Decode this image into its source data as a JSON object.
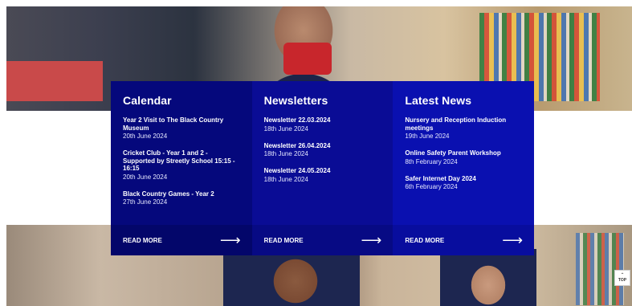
{
  "calendar": {
    "title": "Calendar",
    "items": [
      {
        "title": "Year 2 Visit to The Black Country Museum",
        "date": "20th June 2024"
      },
      {
        "title": "Cricket Club - Year 1 and 2 - Supported by Streetly School 15:15 - 16:15",
        "date": "20th June 2024"
      },
      {
        "title": "Black Country Games - Year 2",
        "date": "27th June 2024"
      }
    ],
    "read_more": "READ MORE"
  },
  "newsletters": {
    "title": "Newsletters",
    "items": [
      {
        "title": "Newsletter 22.03.2024",
        "date": "18th June 2024"
      },
      {
        "title": "Newsletter 26.04.2024",
        "date": "18th June 2024"
      },
      {
        "title": "Newsletter 24.05.2024",
        "date": "18th June 2024"
      }
    ],
    "read_more": "READ MORE"
  },
  "news": {
    "title": "Latest News",
    "items": [
      {
        "title": "Nursery and Reception Induction meetings",
        "date": "19th June 2024"
      },
      {
        "title": "Online Safety Parent Workshop",
        "date": "8th February 2024"
      },
      {
        "title": "Safer Internet Day 2024",
        "date": "6th February 2024"
      }
    ],
    "read_more": "READ MORE"
  },
  "icons": {
    "arrow": "arrow-right-icon",
    "top": "chevron-up-icon"
  },
  "top_button": {
    "label": "TOP"
  },
  "colors": {
    "col1": "#05087c",
    "col2": "#0a0c95",
    "col3": "#0a10b0"
  }
}
